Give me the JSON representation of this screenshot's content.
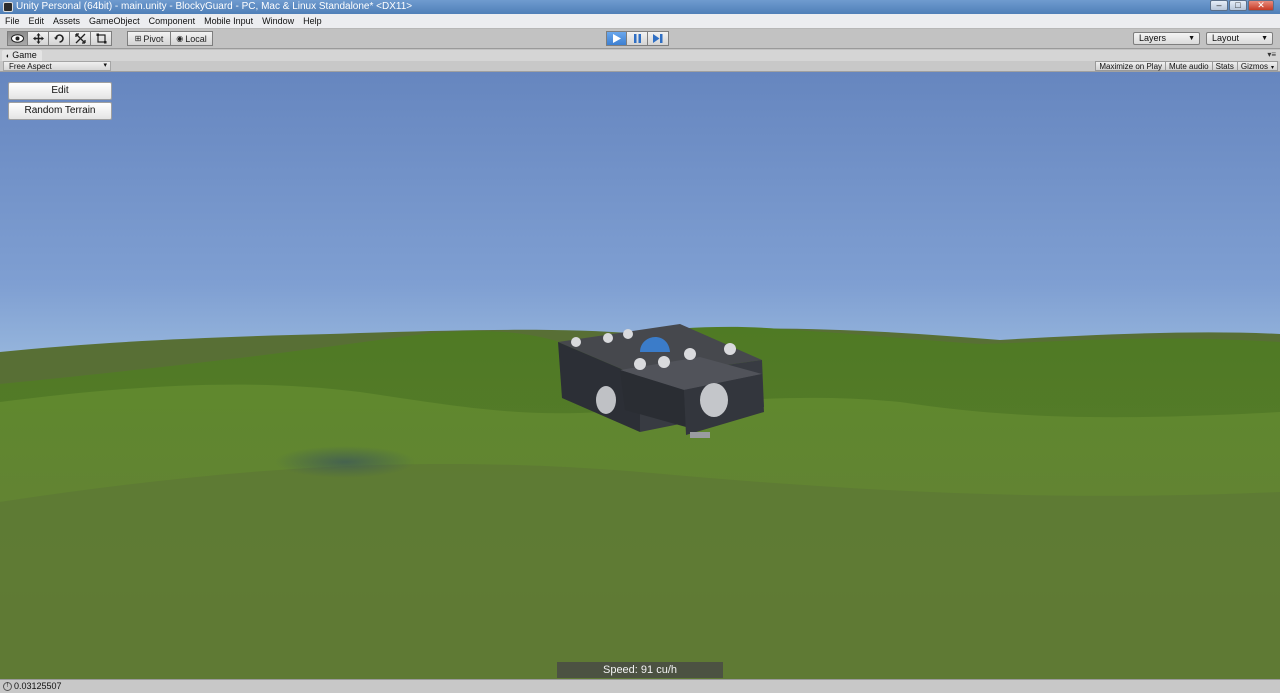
{
  "window": {
    "title": "Unity Personal (64bit) - main.unity - BlockyGuard - PC, Mac & Linux Standalone* <DX11>",
    "controls": [
      "–",
      "□",
      "✕"
    ]
  },
  "menu": [
    "File",
    "Edit",
    "Assets",
    "GameObject",
    "Component",
    "Mobile Input",
    "Window",
    "Help"
  ],
  "toolbar": {
    "transform_tools": [
      "hand-icon",
      "move-icon",
      "rotate-icon",
      "scale-icon",
      "rect-icon"
    ],
    "pivot_label": "Pivot",
    "local_label": "Local",
    "play_icons": [
      "play-icon",
      "pause-icon",
      "step-icon"
    ],
    "layers_label": "Layers",
    "layout_label": "Layout"
  },
  "game_tab": {
    "label": "Game",
    "aspect_label": "Free Aspect",
    "buttons": {
      "maximize": "Maximize on Play",
      "mute": "Mute audio",
      "stats": "Stats",
      "gizmos": "Gizmos"
    }
  },
  "game_gui": {
    "edit_label": "Edit",
    "random_terrain_label": "Random Terrain",
    "speed_text": "Speed: 91 cu/h"
  },
  "status": {
    "text": "0.03125507"
  },
  "colors": {
    "play_accent": "#3d7fd1",
    "grass": "#5b7a2c",
    "sky": "#7f9fd2"
  }
}
